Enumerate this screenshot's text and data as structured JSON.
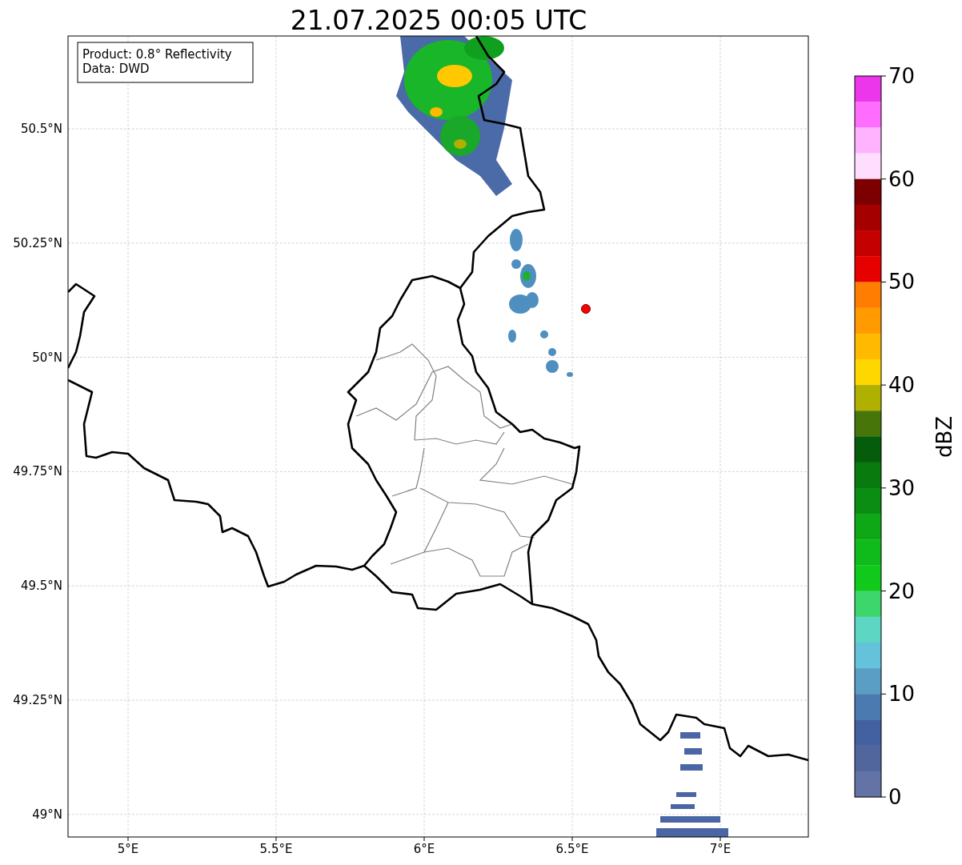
{
  "title": "21.07.2025 00:05 UTC",
  "info_box": [
    "Product: 0.8° Reflectivity",
    "Data: DWD"
  ],
  "x_ticks": [
    "5°E",
    "5.5°E",
    "6°E",
    "6.5°E",
    "7°E"
  ],
  "y_ticks": [
    "50.5°N",
    "50.25°N",
    "50°N",
    "49.75°N",
    "49.5°N",
    "49.25°N",
    "49°N"
  ],
  "colorbar": {
    "label": "dBZ",
    "ticks": [
      "70",
      "60",
      "50",
      "40",
      "30",
      "20",
      "10",
      "0"
    ],
    "segments": [
      {
        "color": "#ec36ec"
      },
      {
        "color": "#ff6dff"
      },
      {
        "color": "#ffb3ff"
      },
      {
        "color": "#ffddff"
      },
      {
        "color": "#7d0000"
      },
      {
        "color": "#a50000"
      },
      {
        "color": "#c40000"
      },
      {
        "color": "#e60000"
      },
      {
        "color": "#ff7d00"
      },
      {
        "color": "#ff9b00"
      },
      {
        "color": "#ffb900"
      },
      {
        "color": "#ffd700"
      },
      {
        "color": "#b0b000"
      },
      {
        "color": "#47750a"
      },
      {
        "color": "#055c0a"
      },
      {
        "color": "#097a0e"
      },
      {
        "color": "#0b8c12"
      },
      {
        "color": "#0ea817"
      },
      {
        "color": "#0fbb1b"
      },
      {
        "color": "#10c91a"
      },
      {
        "color": "#3dd66c"
      },
      {
        "color": "#5ed6c4"
      },
      {
        "color": "#64c2da"
      },
      {
        "color": "#5a9ec6"
      },
      {
        "color": "#4a7ab0"
      },
      {
        "color": "#4360a0"
      },
      {
        "color": "#52669e"
      },
      {
        "color": "#6473a5"
      }
    ]
  }
}
